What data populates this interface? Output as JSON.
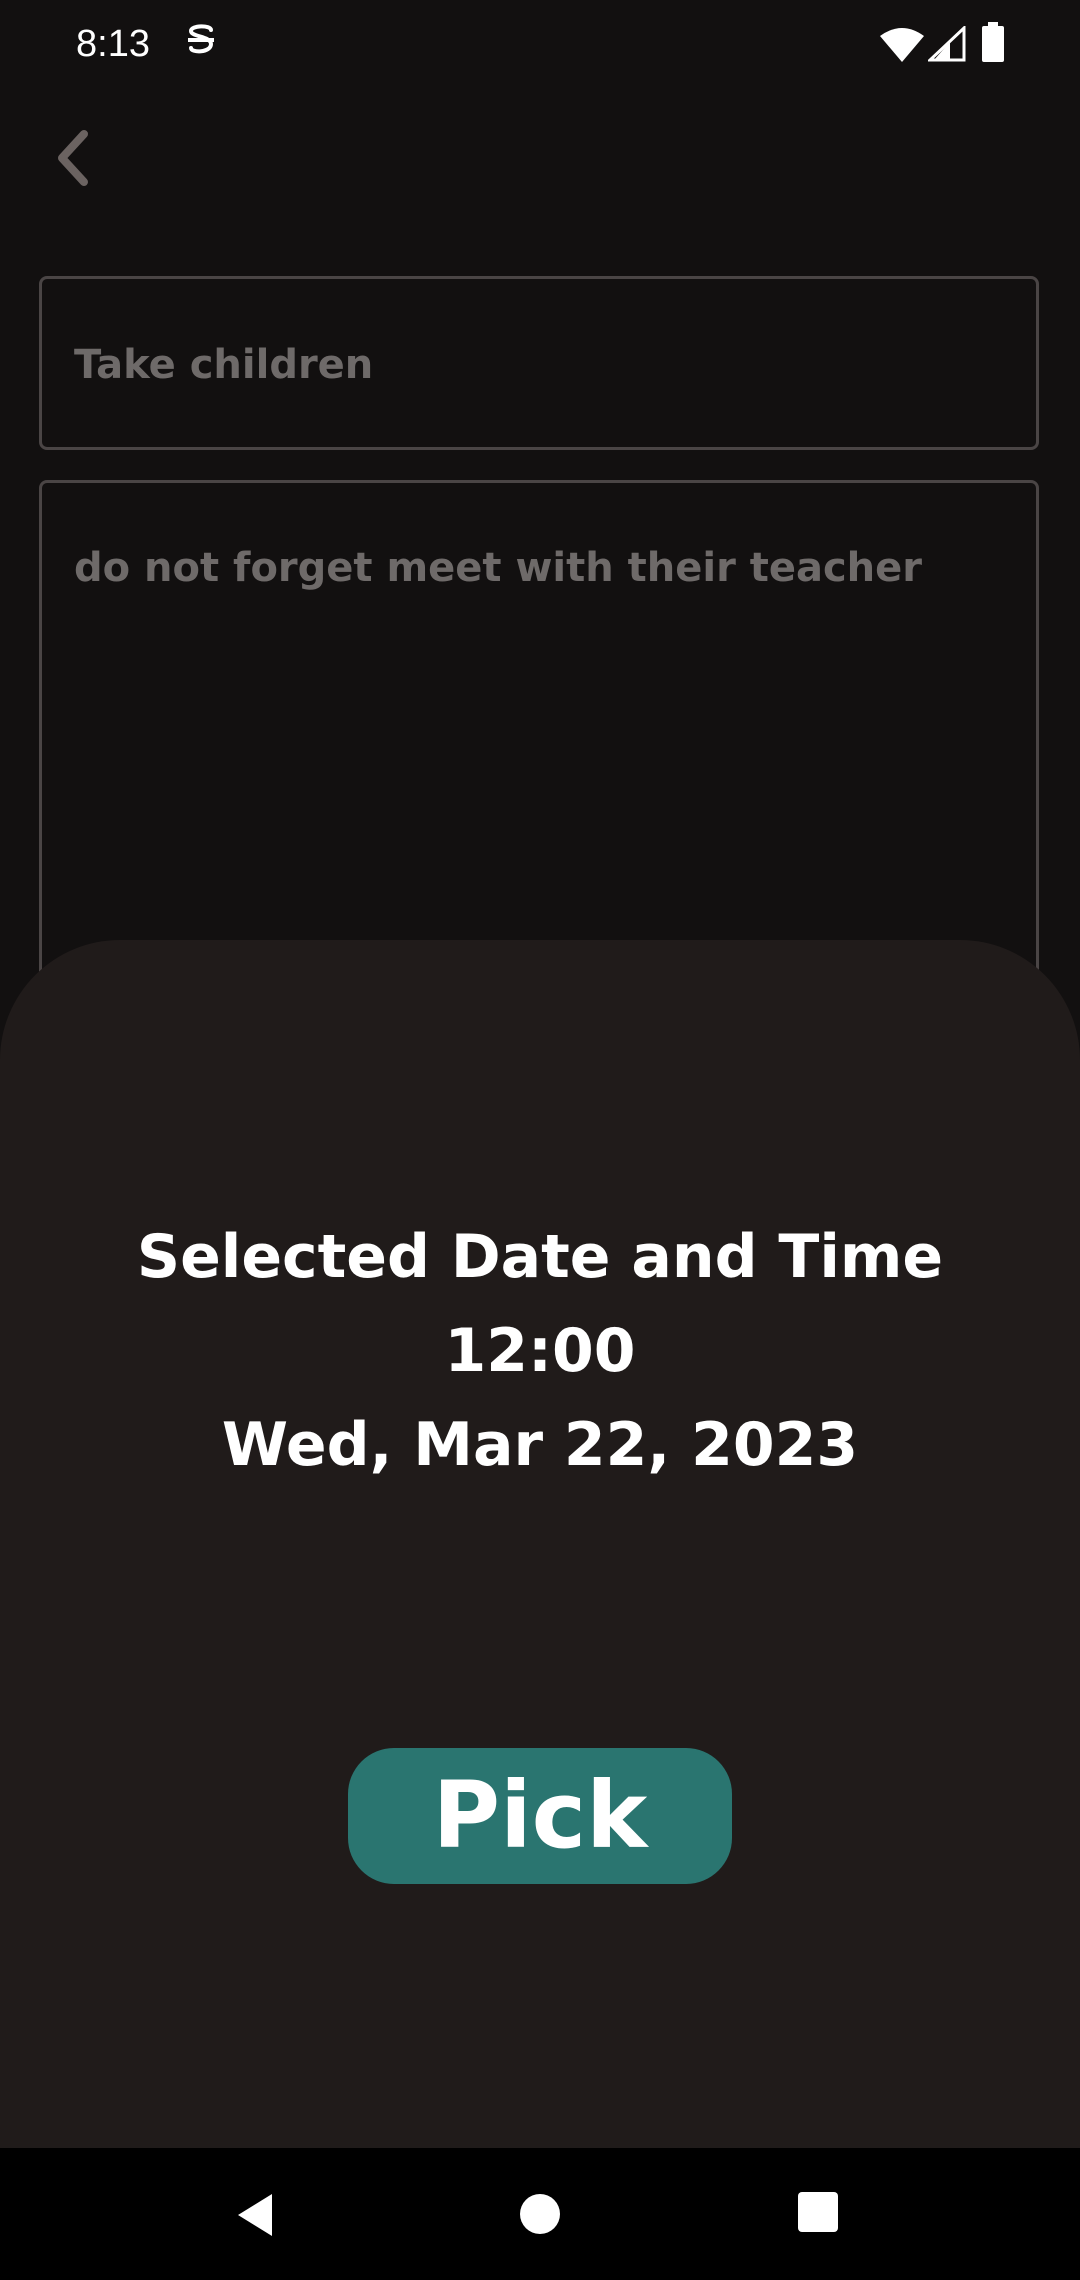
{
  "status_bar": {
    "time": "8:13",
    "icons": [
      "app-notification-icon",
      "wifi-icon",
      "signal-icon",
      "battery-icon"
    ]
  },
  "header": {
    "back_icon": "chevron-left-icon"
  },
  "form": {
    "title_value": "Take children",
    "description_value": "do not forget meet with their teacher"
  },
  "bottom_sheet": {
    "heading": "Selected Date and Time",
    "time": "12:00",
    "date": "Wed, Mar 22, 2023",
    "pick_label": "Pick"
  },
  "nav_bar": {
    "icons": [
      "back-triangle-icon",
      "home-circle-icon",
      "recents-square-icon"
    ]
  },
  "colors": {
    "background": "#121010",
    "sheet": "#201b1a",
    "accent": "#2a7570",
    "field_border": "#4a4545",
    "field_text": "#6e6a69"
  }
}
